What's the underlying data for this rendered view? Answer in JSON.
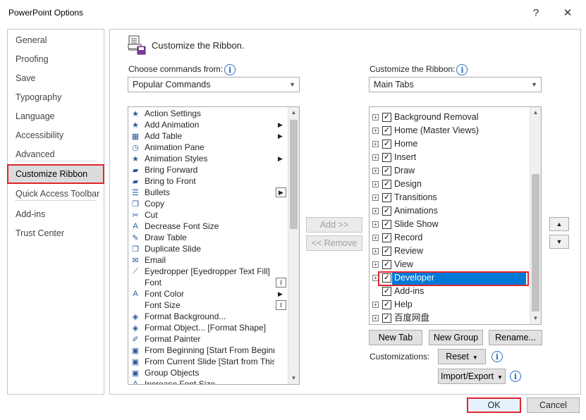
{
  "window": {
    "title": "PowerPoint Options",
    "help_glyph": "?",
    "close_glyph": "✕"
  },
  "nav": {
    "items": [
      {
        "label": "General"
      },
      {
        "label": "Proofing"
      },
      {
        "label": "Save"
      },
      {
        "label": "Typography"
      },
      {
        "label": "Language"
      },
      {
        "label": "Accessibility"
      },
      {
        "label": "Advanced"
      },
      {
        "label": "Customize Ribbon",
        "selected": true
      },
      {
        "label": "Quick Access Toolbar"
      },
      {
        "label": "Add-ins"
      },
      {
        "label": "Trust Center"
      }
    ]
  },
  "header": {
    "title": "Customize the Ribbon.",
    "icon": "customize-ribbon-icon"
  },
  "commands": {
    "label": "Choose commands from:",
    "dropdown_value": "Popular Commands",
    "items": [
      {
        "label": "Action Settings",
        "icon": "★"
      },
      {
        "label": "Add Animation",
        "icon": "★",
        "sub": "▶"
      },
      {
        "label": "Add Table",
        "icon": "▦",
        "sub": "▶"
      },
      {
        "label": "Animation Pane",
        "icon": "◷"
      },
      {
        "label": "Animation Styles",
        "icon": "★",
        "sub": "▶"
      },
      {
        "label": "Bring Forward",
        "icon": "▰"
      },
      {
        "label": "Bring to Front",
        "icon": "▰"
      },
      {
        "label": "Bullets",
        "icon": "☰",
        "box": "▶"
      },
      {
        "label": "Copy",
        "icon": "❐"
      },
      {
        "label": "Cut",
        "icon": "✂"
      },
      {
        "label": "Decrease Font Size",
        "icon": "A"
      },
      {
        "label": "Draw Table",
        "icon": "✎"
      },
      {
        "label": "Duplicate Slide",
        "icon": "❐"
      },
      {
        "label": "Email",
        "icon": "✉"
      },
      {
        "label": "Eyedropper [Eyedropper Text Fill]",
        "icon": "⟋"
      },
      {
        "label": "Font",
        "icon": "",
        "box": "I"
      },
      {
        "label": "Font Color",
        "icon": "A",
        "sub": "▶"
      },
      {
        "label": "Font Size",
        "icon": "",
        "box": "I"
      },
      {
        "label": "Format Background...",
        "icon": "◈"
      },
      {
        "label": "Format Object... [Format Shape]",
        "icon": "◈"
      },
      {
        "label": "Format Painter",
        "icon": "✐"
      },
      {
        "label": "From Beginning [Start From Beginning]",
        "icon": "▣"
      },
      {
        "label": "From Current Slide [Start from This Slide]",
        "icon": "▣"
      },
      {
        "label": "Group Objects",
        "icon": "▣"
      },
      {
        "label": "Increase Font Size",
        "icon": "A"
      }
    ]
  },
  "tabs": {
    "label": "Customize the Ribbon:",
    "dropdown_value": "Main Tabs",
    "items": [
      {
        "label": "Background Removal",
        "checked": true,
        "expander": "+"
      },
      {
        "label": "Home (Master Views)",
        "checked": true,
        "expander": "+"
      },
      {
        "label": "Home",
        "checked": true,
        "expander": "+"
      },
      {
        "label": "Insert",
        "checked": true,
        "expander": "+"
      },
      {
        "label": "Draw",
        "checked": true,
        "expander": "+"
      },
      {
        "label": "Design",
        "checked": true,
        "expander": "+"
      },
      {
        "label": "Transitions",
        "checked": true,
        "expander": "+"
      },
      {
        "label": "Animations",
        "checked": true,
        "expander": "+"
      },
      {
        "label": "Slide Show",
        "checked": true,
        "expander": "+"
      },
      {
        "label": "Record",
        "checked": true,
        "expander": "+"
      },
      {
        "label": "Review",
        "checked": true,
        "expander": "+"
      },
      {
        "label": "View",
        "checked": true,
        "expander": "+"
      },
      {
        "label": "Developer",
        "checked": true,
        "expander": "+",
        "selected": true
      },
      {
        "label": "Add-ins",
        "checked": true,
        "expander": ""
      },
      {
        "label": "Help",
        "checked": true,
        "expander": "+"
      },
      {
        "label": "百度网盘",
        "checked": true,
        "expander": "+"
      }
    ]
  },
  "buttons": {
    "add": "Add >>",
    "remove": "<< Remove",
    "new_tab": "New Tab",
    "new_group": "New Group",
    "rename": "Rename...",
    "customizations_label": "Customizations:",
    "reset": "Reset",
    "import_export": "Import/Export",
    "move_up": "▲",
    "move_down": "▼",
    "ok": "OK",
    "cancel": "Cancel"
  },
  "colors": {
    "selection": "#0078d7",
    "highlight_outline": "#e0262f",
    "info": "#2b6fc0"
  }
}
